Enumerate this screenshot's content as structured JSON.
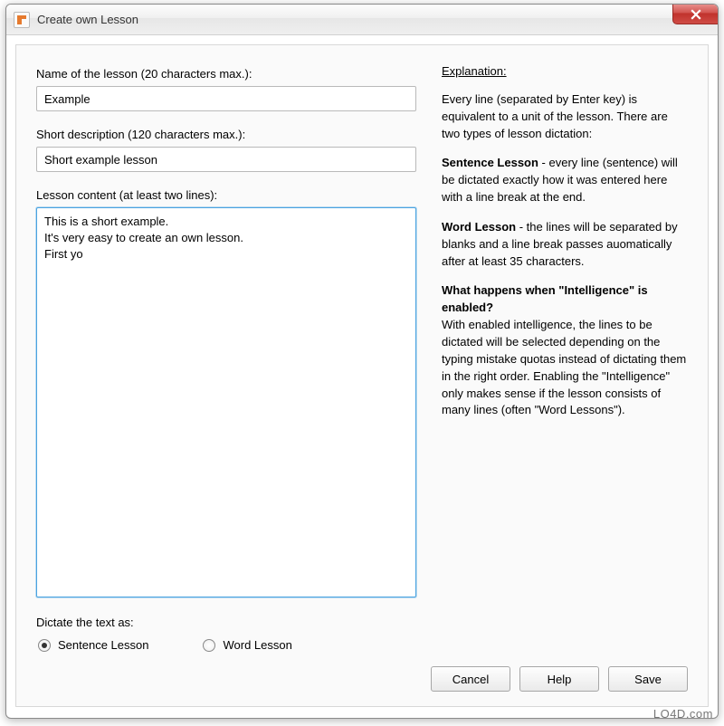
{
  "window": {
    "title": "Create own Lesson"
  },
  "form": {
    "name_label": "Name of the lesson (20 characters max.):",
    "name_value": "Example",
    "desc_label": "Short description (120 characters max.):",
    "desc_value": "Short example lesson",
    "content_label": "Lesson content (at least two lines):",
    "content_value": "This is a short example.\nIt's very easy to create an own lesson.\nFirst yo",
    "dictate_label": "Dictate the text as:",
    "radio_sentence": "Sentence Lesson",
    "radio_word": "Word Lesson"
  },
  "explanation": {
    "heading": "Explanation:",
    "p1": "Every line (separated by Enter key) is equivalent to a unit of the lesson. There are two types of lesson dictation:",
    "sentence_bold": "Sentence Lesson",
    "sentence_rest": " - every line (sentence) will be dictated exactly how it was entered here with a line break at the end.",
    "word_bold": "Word Lesson",
    "word_rest": " - the lines will be separated by blanks and a line break passes auomatically after at least 35 characters.",
    "intel_heading": "What happens when \"Intelligence\" is enabled?",
    "intel_body": "With enabled intelligence, the lines to be dictated will be selected depending on the typing mistake quotas instead of dictating them in the right order. Enabling the \"Intelligence\" only makes sense if the lesson consists of many lines (often \"Word Lessons\")."
  },
  "buttons": {
    "cancel": "Cancel",
    "help": "Help",
    "save": "Save"
  },
  "watermark": "LO4D.com"
}
